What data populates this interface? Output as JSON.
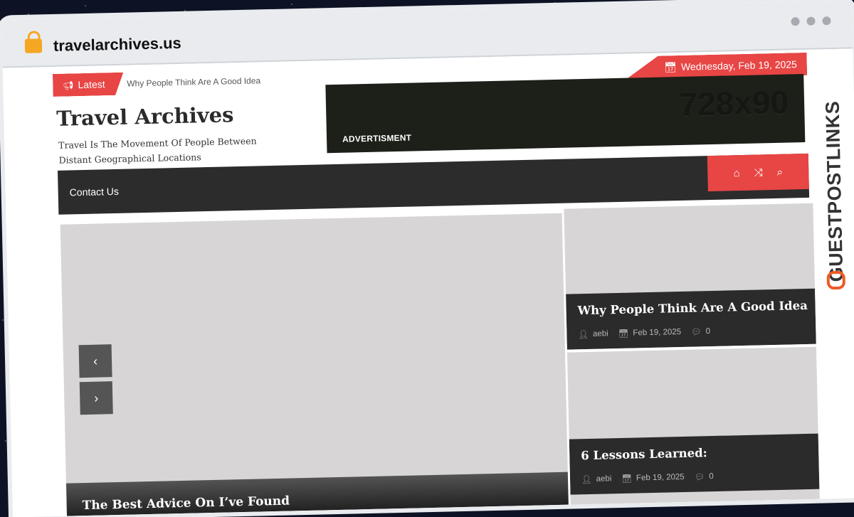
{
  "browser": {
    "url": "travelarchives.us"
  },
  "topbar": {
    "latest_label": "Latest",
    "ticker_text": "Why People Think Are A Good Idea",
    "date": "Wednesday, Feb 19, 2025"
  },
  "header": {
    "site_title": "Travel Archives",
    "tagline": "Travel Is The Movement Of People Between Distant Geographical Locations",
    "ad_size": "728x90",
    "ad_label": "ADVERTISMENT"
  },
  "nav": {
    "items": [
      "Contact Us"
    ],
    "icons": [
      "home-icon",
      "shuffle-icon",
      "search-icon"
    ]
  },
  "slider": {
    "main_title": "The Best Advice On I’ve Found",
    "prev_icon": "chevron-left-icon",
    "next_icon": "chevron-right-icon"
  },
  "side_posts": [
    {
      "title": "Why People Think Are A Good Idea",
      "author": "aebi",
      "date": "Feb 19, 2025",
      "comments": "0"
    },
    {
      "title": "6 Lessons Learned:",
      "author": "aebi",
      "date": "Feb 19, 2025",
      "comments": "0"
    }
  ],
  "watermark": {
    "brand": "GUESTPOSTLINKS"
  },
  "colors": {
    "accent": "#e84545",
    "nav_bg": "#2c2c2c",
    "ad_bg": "#1c2019"
  }
}
